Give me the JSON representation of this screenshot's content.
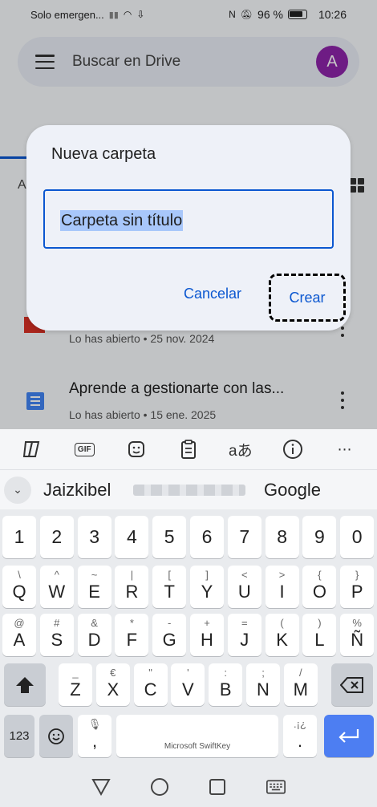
{
  "status_bar": {
    "carrier": "Solo emergen...",
    "battery_pct": "96 %",
    "time": "10:26"
  },
  "drive": {
    "search_placeholder": "Buscar en Drive",
    "avatar_letter": "A",
    "avatar_color": "#8e24aa",
    "section_letter": "A",
    "files": [
      {
        "title": "",
        "meta": "Lo has abierto • 25 nov. 2024",
        "type": "pdf"
      },
      {
        "title": "Aprende a gestionarte con las...",
        "meta": "Lo has abierto • 15 ene. 2025",
        "type": "doc"
      }
    ]
  },
  "dialog": {
    "title": "Nueva carpeta",
    "input_value": "Carpeta sin título",
    "cancel_label": "Cancelar",
    "create_label": "Crear",
    "accent": "#0b57d0"
  },
  "keyboard": {
    "toolbar": [
      "copilot-icon",
      "gif-icon",
      "sticker-icon",
      "clipboard-icon",
      "translate-icon",
      "info-icon",
      "more-icon"
    ],
    "gif_label": "GIF",
    "translate_label": "aあ",
    "suggestions": [
      "Jaizkibel",
      "",
      "Google"
    ],
    "brand": "Microsoft SwiftKey",
    "row_numbers": [
      "1",
      "2",
      "3",
      "4",
      "5",
      "6",
      "7",
      "8",
      "9",
      "0"
    ],
    "row1": [
      [
        "Q",
        "\\"
      ],
      [
        "W",
        "^"
      ],
      [
        "E",
        "~"
      ],
      [
        "R",
        "|"
      ],
      [
        "T",
        "["
      ],
      [
        "Y",
        "]"
      ],
      [
        "U",
        "<"
      ],
      [
        "I",
        ">"
      ],
      [
        "O",
        "{"
      ],
      [
        "P",
        "}"
      ]
    ],
    "row2": [
      [
        "A",
        "@"
      ],
      [
        "S",
        "#"
      ],
      [
        "D",
        "&"
      ],
      [
        "F",
        "*"
      ],
      [
        "G",
        "-"
      ],
      [
        "H",
        "+"
      ],
      [
        "J",
        "="
      ],
      [
        "K",
        "("
      ],
      [
        "L",
        ")"
      ],
      [
        "Ñ",
        "%"
      ]
    ],
    "row3": [
      [
        "Z",
        "_"
      ],
      [
        "X",
        "€"
      ],
      [
        "C",
        "\""
      ],
      [
        "V",
        "'"
      ],
      [
        "B",
        ":"
      ],
      [
        "N",
        ";"
      ],
      [
        "M",
        "/"
      ]
    ],
    "sym_label": "123",
    "comma": ",",
    "period": ".",
    "period_sup": ".¡¿",
    "accent_blue": "#4d7ef2"
  }
}
